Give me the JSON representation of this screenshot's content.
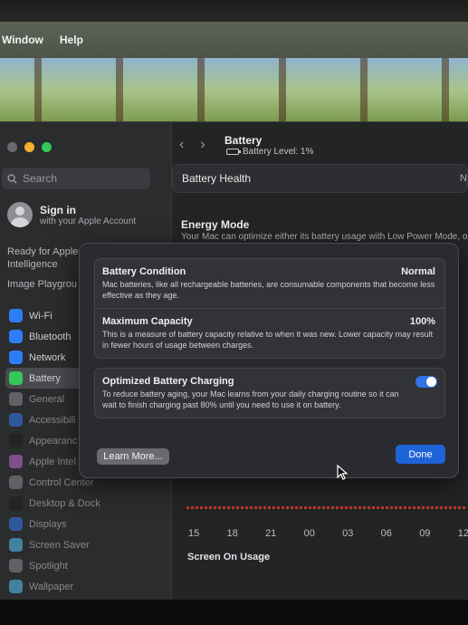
{
  "menubar": {
    "items": [
      "Window",
      "Help"
    ]
  },
  "sidebar": {
    "search_placeholder": "Search",
    "signin": {
      "title": "Sign in",
      "subtitle": "with your Apple Account"
    },
    "promo_text": [
      "Ready for Apple",
      "Intelligence"
    ],
    "image_playground": "Image Playgrou",
    "items": [
      {
        "label": "Wi-Fi",
        "color": "#2f7df6",
        "selected": false,
        "faded": false
      },
      {
        "label": "Bluetooth",
        "color": "#2f7df6",
        "selected": false,
        "faded": false
      },
      {
        "label": "Network",
        "color": "#2f7df6",
        "selected": false,
        "faded": false
      },
      {
        "label": "Battery",
        "color": "#34c759",
        "selected": true,
        "faded": false
      },
      {
        "label": "General",
        "color": "#8e8e93",
        "selected": false,
        "faded": true
      },
      {
        "label": "Accessibili",
        "color": "#2f7df6",
        "selected": false,
        "faded": true
      },
      {
        "label": "Appearanc",
        "color": "#1c1c1e",
        "selected": false,
        "faded": true
      },
      {
        "label": "Apple Intel",
        "color": "#c86bdc",
        "selected": false,
        "faded": true
      },
      {
        "label": "Control Center",
        "color": "#8e8e93",
        "selected": false,
        "faded": true
      },
      {
        "label": "Desktop & Dock",
        "color": "#1c1c1e",
        "selected": false,
        "faded": true
      },
      {
        "label": "Displays",
        "color": "#2f7df6",
        "selected": false,
        "faded": true
      },
      {
        "label": "Screen Saver",
        "color": "#5ac8fa",
        "selected": false,
        "faded": true
      },
      {
        "label": "Spotlight",
        "color": "#8e8e93",
        "selected": false,
        "faded": true
      },
      {
        "label": "Wallpaper",
        "color": "#5ac8fa",
        "selected": false,
        "faded": true
      }
    ]
  },
  "main": {
    "title": "Battery",
    "battery_level": "Battery Level: 1%",
    "health_row": {
      "label": "Battery Health",
      "value": "N"
    },
    "energy_mode": {
      "title": "Energy Mode",
      "desc": "Your Mac can optimize either its battery usage with Low Power Mode, o"
    },
    "chart_axis": [
      "15",
      "18",
      "21",
      "00",
      "03",
      "06",
      "09",
      "12"
    ],
    "screen_on_usage": "Screen On Usage"
  },
  "sheet": {
    "condition": {
      "title": "Battery Condition",
      "value": "Normal",
      "desc": "Mac batteries, like all rechargeable batteries, are consumable components that become less effective as they age."
    },
    "capacity": {
      "title": "Maximum Capacity",
      "value": "100%",
      "desc": "This is a measure of battery capacity relative to when it was new. Lower capacity may result in fewer hours of usage between charges."
    },
    "optimized": {
      "title": "Optimized Battery Charging",
      "enabled": true,
      "desc": "To reduce battery aging, your Mac learns from your daily charging routine so it can wait to finish charging past 80% until you need to use it on battery."
    },
    "learn_more": "Learn More...",
    "done": "Done"
  }
}
